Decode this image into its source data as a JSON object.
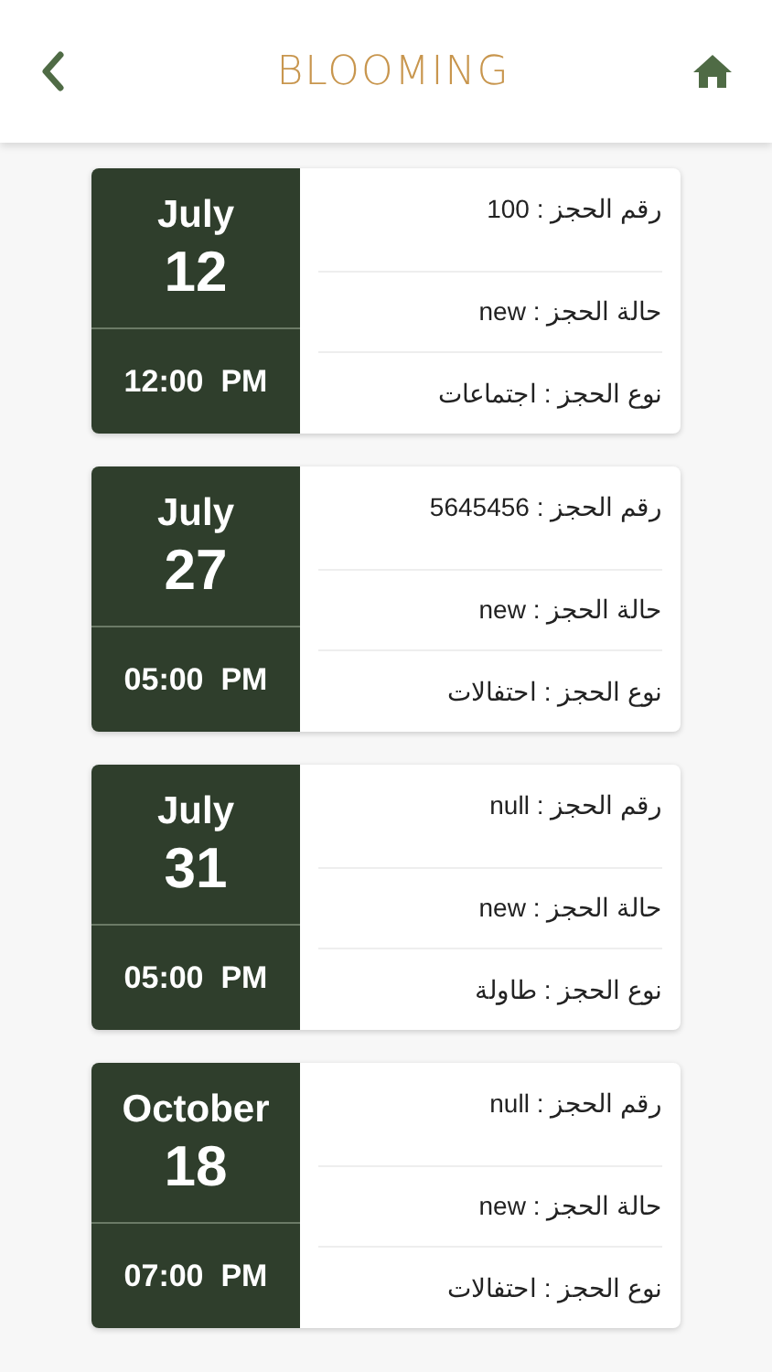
{
  "header": {
    "title": "BLOOMING"
  },
  "bookings": [
    {
      "month": "July",
      "day": "12",
      "time": "12:00  PM",
      "rows": [
        "رقم الحجز : 100",
        "حالة الحجز : new",
        "نوع الحجز : اجتماعات"
      ]
    },
    {
      "month": "July",
      "day": "27",
      "time": "05:00  PM",
      "rows": [
        "رقم الحجز : 5645456",
        "حالة الحجز : new",
        "نوع الحجز : احتفالات"
      ]
    },
    {
      "month": "July",
      "day": "31",
      "time": "05:00  PM",
      "rows": [
        "رقم الحجز : null",
        "حالة الحجز : new",
        "نوع الحجز : طاولة"
      ]
    },
    {
      "month": "October",
      "day": "18",
      "time": "07:00  PM",
      "rows": [
        "رقم الحجز : null",
        "حالة الحجز : new",
        "نوع الحجز : احتفالات"
      ]
    }
  ]
}
